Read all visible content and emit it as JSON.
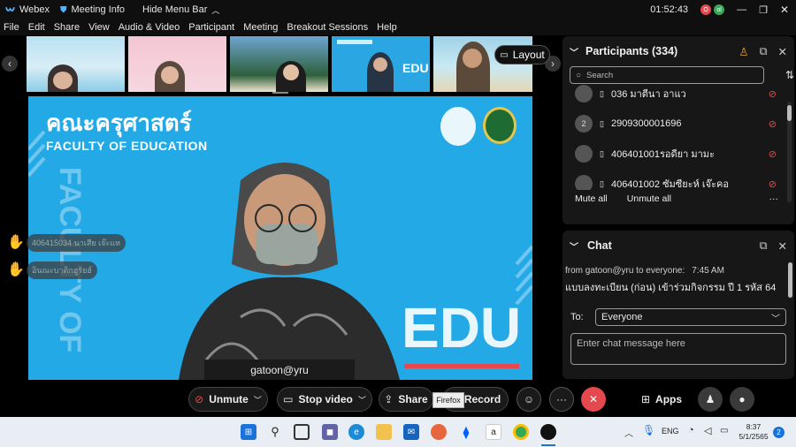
{
  "titlebar": {
    "app": "Webex",
    "meeting_info": "Meeting Info",
    "hide_menu": "Hide Menu Bar",
    "time": "01:52:43",
    "avatar_initial_1": "O",
    "avatar_initial_2": "ol"
  },
  "menu": [
    "File",
    "Edit",
    "Share",
    "View",
    "Audio & Video",
    "Participant",
    "Meeting",
    "Breakout Sessions",
    "Help"
  ],
  "layout_label": "Layout",
  "stage": {
    "brand_thai": "คณะครุศาสตร์",
    "brand_en": "FACULTY OF EDUCATION",
    "side_text": "FACULTY OF EDUCATI",
    "edu_text": "EDU",
    "speaker_name": "gatoon@yru"
  },
  "reactions": [
    "406415034 นาเสีย เจ๊ะแห",
    "อินณะบาติกฮูรัยฮ์"
  ],
  "participants": {
    "title": "Participants (334)",
    "search_placeholder": "Search",
    "rows": [
      {
        "avatar": "",
        "name": "036 มาตีนา อาแว"
      },
      {
        "avatar": "2",
        "name": "2909300001696"
      },
      {
        "avatar": "",
        "name": "406401001รอดียา มามะ"
      },
      {
        "avatar": "",
        "name": "406401002 ซัมซียะห์ เจ๊ะคอ"
      }
    ],
    "mute_all": "Mute all",
    "unmute_all": "Unmute all",
    "more": "···"
  },
  "chat": {
    "title": "Chat",
    "from": "from gatoon@yru to everyone:",
    "time": "7:45 AM",
    "message": "แบบลงทะเบียน (ก่อน) เข้าร่วมกิจกรรม ปี 1 รหัส 64",
    "to_label": "To:",
    "to_value": "Everyone",
    "input_placeholder": "Enter chat message here"
  },
  "controls": {
    "unmute": "Unmute",
    "stop_video": "Stop video",
    "share": "Share",
    "record": "Record",
    "apps": "Apps",
    "more": "···"
  },
  "tooltip": "Firefox",
  "taskbar": {
    "lang": "ENG",
    "time": "8:37",
    "date": "5/1/2565",
    "notif_count": "2"
  },
  "colors": {
    "stage_blue": "#23a9e6",
    "end_red": "#e5484d",
    "panel_bg": "#171717"
  }
}
